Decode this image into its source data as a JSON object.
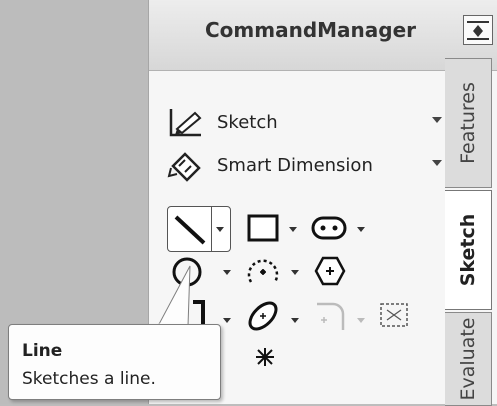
{
  "command_manager": {
    "title": "CommandManager",
    "pin_icon": "pin-icon"
  },
  "menu": [
    {
      "label": "Sketch",
      "icon": "sketch-icon"
    },
    {
      "label": "Smart Dimension",
      "icon": "smart-dimension-icon"
    }
  ],
  "tools": [
    "line-icon",
    "rectangle-icon",
    "slot-icon",
    "circle-icon",
    "arc-icon",
    "polygon-icon",
    "spline-icon",
    "ellipse-icon",
    "fillet-icon",
    "text-icon",
    "point-icon"
  ],
  "tabs": [
    {
      "label": "Features",
      "active": false
    },
    {
      "label": "Sketch",
      "active": true
    },
    {
      "label": "Evaluate",
      "active": false
    }
  ],
  "tooltip": {
    "title": "Line",
    "description": "Sketches a line."
  }
}
